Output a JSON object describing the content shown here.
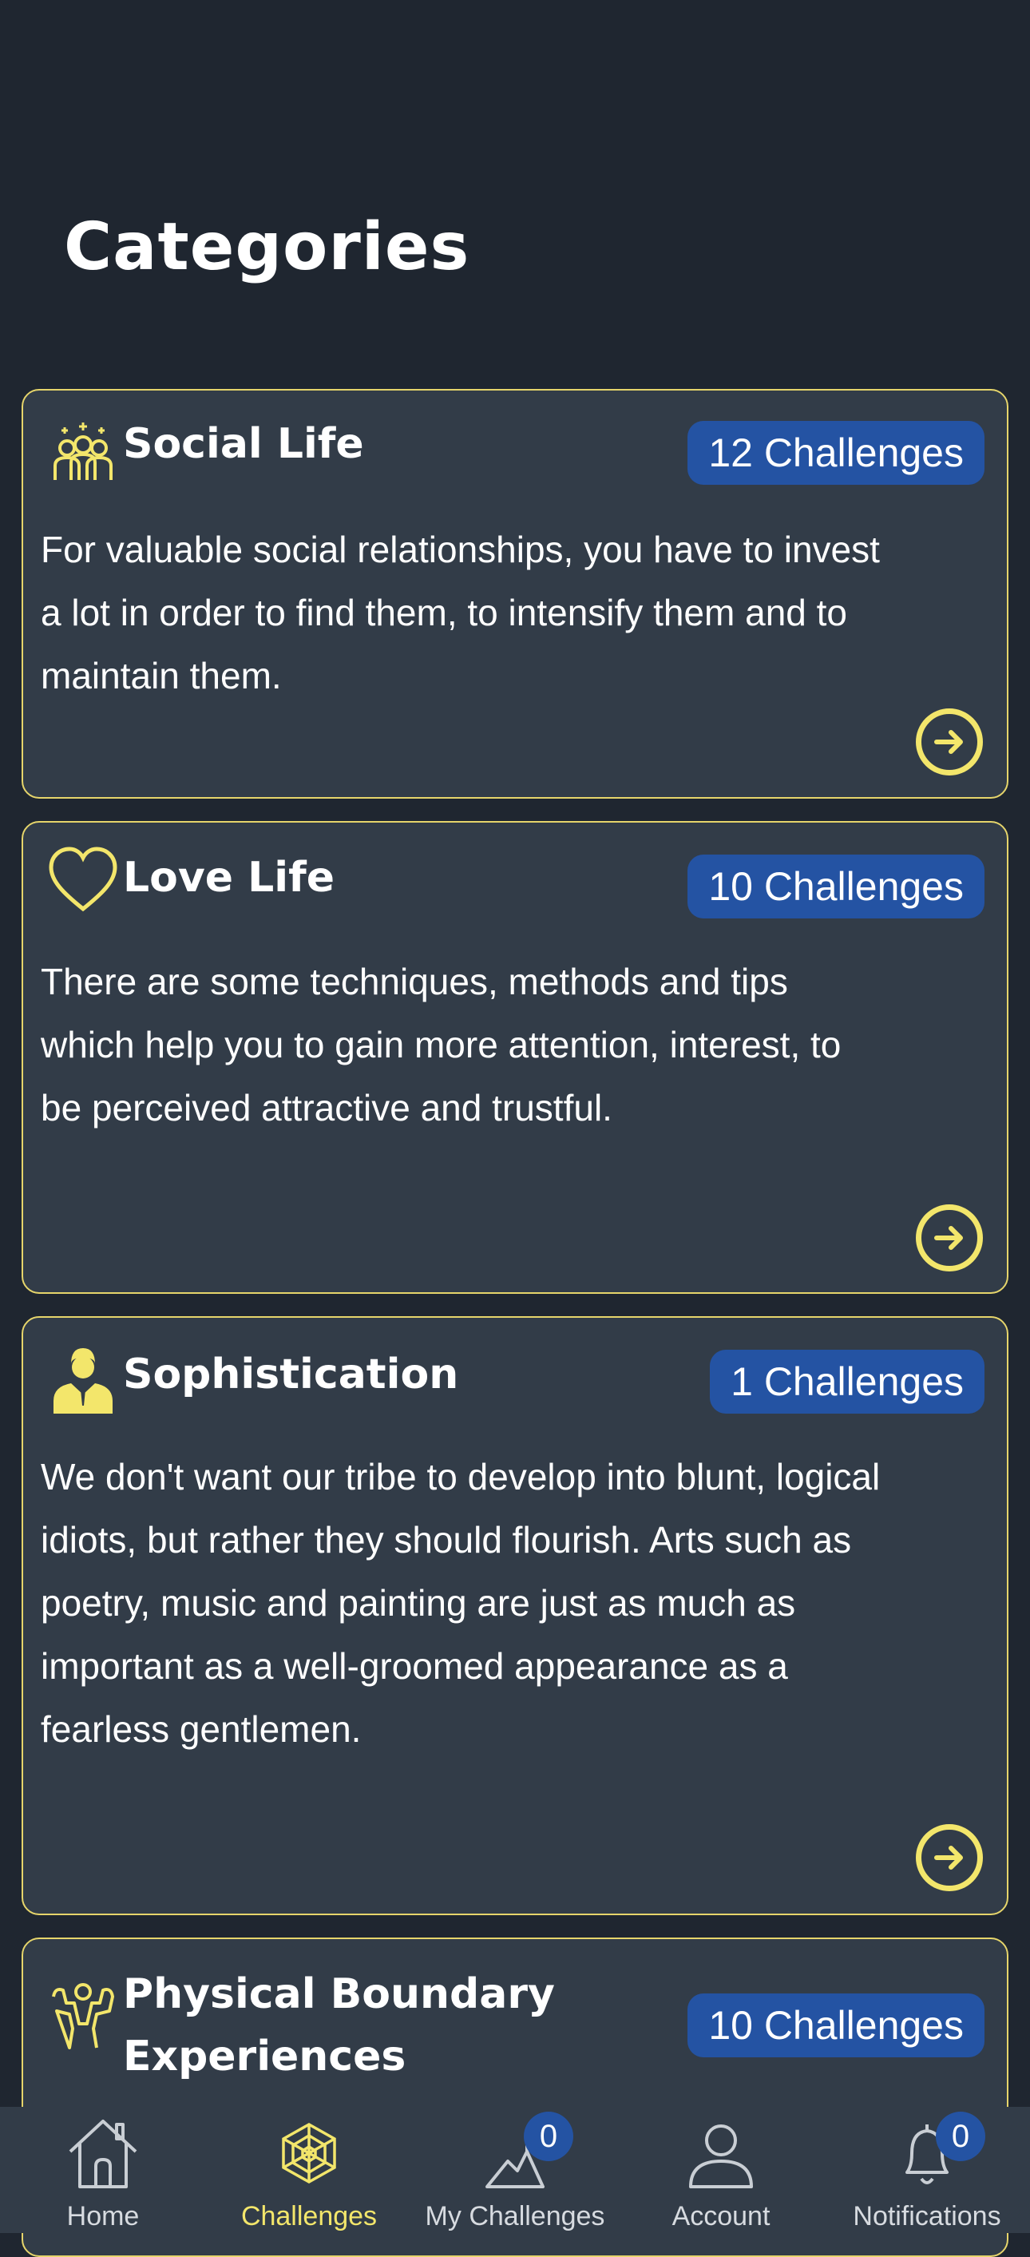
{
  "page": {
    "title": "Categories"
  },
  "categories": [
    {
      "title": "Social Life",
      "badge": "12 Challenges",
      "icon": "group-people-icon",
      "description": "For valuable social relationships, you have to invest a lot in order to find them, to intensify them and to maintain them."
    },
    {
      "title": "Love Life",
      "badge": "10 Challenges",
      "icon": "heart-icon",
      "description": "There are some techniques, methods and tips which help you to gain more attention, interest, to be perceived attractive and trustful."
    },
    {
      "title": "Sophistication",
      "badge": "1 Challenges",
      "icon": "gentleman-icon",
      "description": "We don't want our tribe to develop into blunt, logical idiots, but rather they should flourish. Arts such as poetry, music and painting are just as much as important as a well-groomed appearance as a fearless gentlemen."
    },
    {
      "title": "Physical Boundary Experiences",
      "badge": "10 Challenges",
      "icon": "strong-man-icon",
      "description": ""
    }
  ],
  "nav": {
    "items": [
      {
        "label": "Home",
        "icon": "home-icon"
      },
      {
        "label": "Challenges",
        "icon": "web-icon",
        "active": true
      },
      {
        "label": "My Challenges",
        "icon": "mountain-flag-icon",
        "badge": "0"
      },
      {
        "label": "Account",
        "icon": "user-icon"
      },
      {
        "label": "Notifications",
        "icon": "bell-icon",
        "badge": "0"
      }
    ]
  },
  "colors": {
    "background": "#1f2630",
    "card": "#323c48",
    "accent": "#f3e66b",
    "badge": "#2453a3"
  }
}
